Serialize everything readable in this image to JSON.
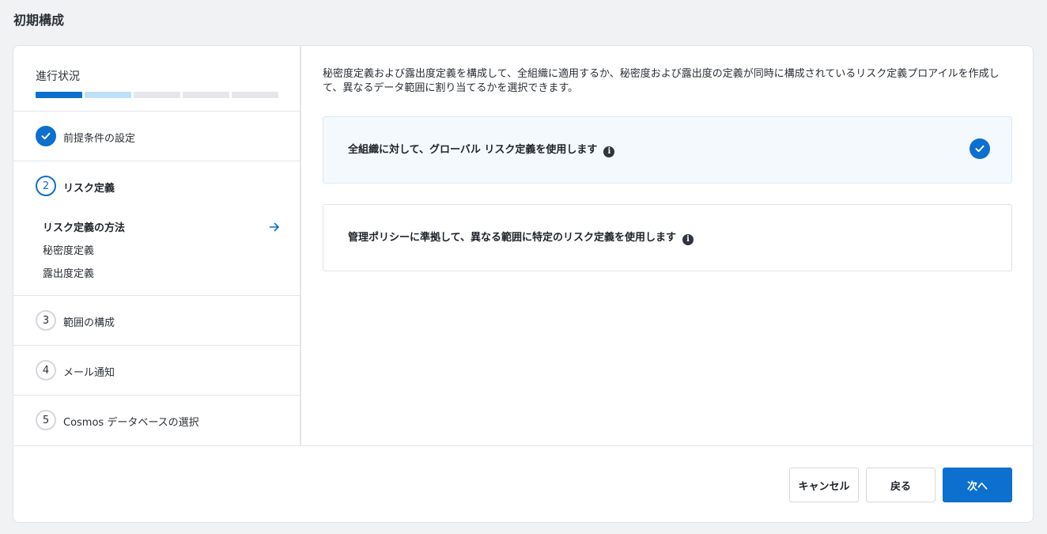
{
  "page": {
    "title": "初期構成"
  },
  "progress": {
    "label": "進行状況",
    "segments": 5,
    "completed": 1,
    "partial": 1
  },
  "steps": [
    {
      "number": "",
      "label": "前提条件の設定",
      "status": "done"
    },
    {
      "number": "2",
      "label": "リスク定義",
      "status": "active",
      "substeps": [
        {
          "label": "リスク定義の方法",
          "active": true
        },
        {
          "label": "秘密度定義",
          "active": false
        },
        {
          "label": "露出度定義",
          "active": false
        }
      ]
    },
    {
      "number": "3",
      "label": "範囲の構成",
      "status": "pending"
    },
    {
      "number": "4",
      "label": "メール通知",
      "status": "pending"
    },
    {
      "number": "5",
      "label": "Cosmos データベースの選択",
      "status": "pending"
    }
  ],
  "main": {
    "description": "秘密度定義および露出度定義を構成して、全組織に適用するか、秘密度および露出度の定義が同時に構成されているリスク定義プロアイルを作成して、異なるデータ範囲に割り当てるかを選択できます。",
    "options": [
      {
        "label": "全組織に対して、グローバル リスク定義を使用します",
        "selected": true
      },
      {
        "label": "管理ポリシーに準拠して、異なる範囲に特定のリスク定義を使用します",
        "selected": false
      }
    ]
  },
  "footer": {
    "cancel_label": "キャンセル",
    "back_label": "戻る",
    "next_label": "次へ"
  },
  "colors": {
    "accent": "#0d6fce",
    "accent_light": "#bfe0f8",
    "selected_bg": "#f4f9fe"
  },
  "icons": {
    "done": "check-icon",
    "info": "info-icon",
    "substep_active": "arrow-right-icon"
  }
}
